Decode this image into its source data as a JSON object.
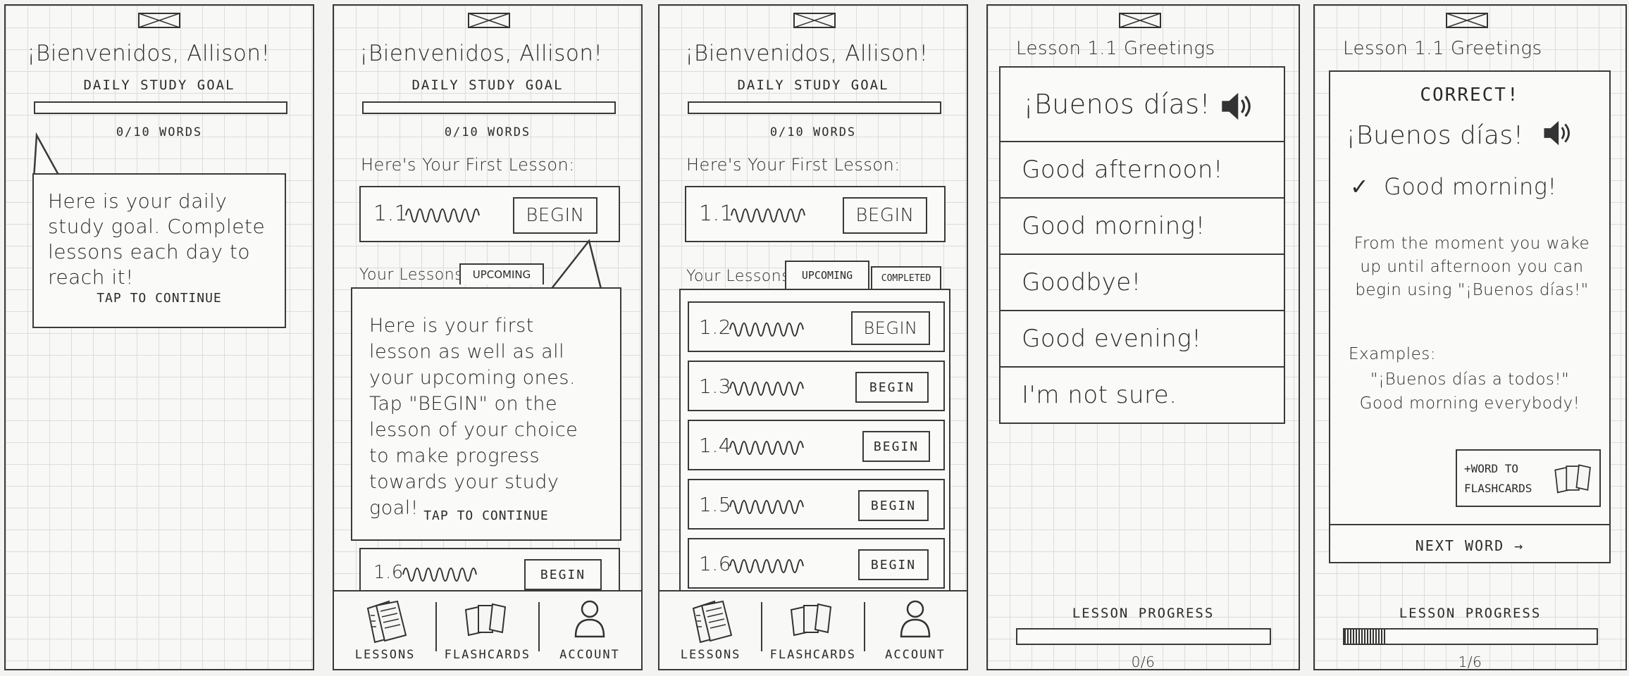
{
  "welcome": "¡Bienvenidos, Allison!",
  "daily_goal_label": "DAILY STUDY GOAL",
  "words_progress": "0/10 WORDS",
  "goal_progress": 0,
  "goal_tooltip": {
    "text": "Here is your daily study goal. Complete lessons each day to reach it!",
    "tap": "TAP TO CONTINUE"
  },
  "first_lesson_label": "Here's Your First Lesson:",
  "first_lesson": {
    "number": "1.1",
    "button": "BEGIN"
  },
  "your_lessons_label": "Your Lessons:",
  "tabs": {
    "upcoming": "UPCOMING",
    "completed": "COMPLETED"
  },
  "lessons": [
    {
      "number": "1.2",
      "button": "BEGIN"
    },
    {
      "number": "1.3",
      "button": "BEGIN"
    },
    {
      "number": "1.4",
      "button": "BEGIN"
    },
    {
      "number": "1.5",
      "button": "BEGIN"
    },
    {
      "number": "1.6",
      "button": "BEGIN"
    }
  ],
  "lesson_tooltip": {
    "text": "Here is your first lesson as well as all your upcoming ones. Tap \"BEGIN\" on the lesson of your choice to make progress towards your study goal!",
    "tap": "TAP TO CONTINUE"
  },
  "nav": {
    "lessons": "LESSONS",
    "flashcards": "FLASHCARDS",
    "account": "ACCOUNT"
  },
  "quiz": {
    "title": "Lesson 1.1 Greetings",
    "prompt": "¡Buenos días!",
    "options": [
      "Good afternoon!",
      "Good morning!",
      "Goodbye!",
      "Good evening!",
      "I'm not sure."
    ],
    "progress_label": "LESSON PROGRESS",
    "progress_text": "0/6",
    "progress": 0
  },
  "result": {
    "title": "Lesson 1.1 Greetings",
    "status": "CORRECT!",
    "prompt": "¡Buenos días!",
    "check": "✓",
    "answer": "Good morning!",
    "explanation": "From the moment you wake up until afternoon you can begin using \"¡Buenos días!\"",
    "examples_label": "Examples:",
    "example_es": "\"¡Buenos días a todos!\"",
    "example_en": "Good morning everybody!",
    "add_flashcard": "+WORD TO FLASHCARDS",
    "next": "NEXT WORD →",
    "progress_label": "LESSON PROGRESS",
    "progress_text": "1/6",
    "progress": 0.1667
  },
  "icons": {
    "logo": "image-placeholder-icon",
    "speaker": "speaker-icon",
    "lessons": "lessons-book-icon",
    "flashcards": "flashcards-icon",
    "account": "account-person-icon"
  }
}
